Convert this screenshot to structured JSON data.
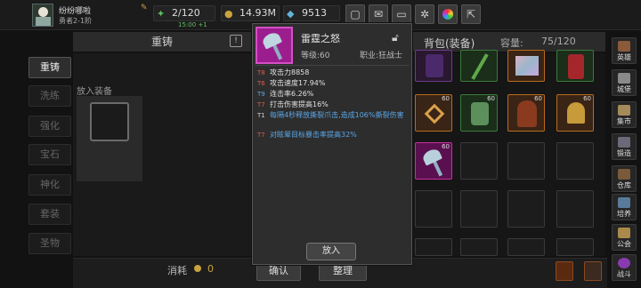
{
  "player": {
    "name": "纷纷哪啦",
    "rank": "勇者2-1阶"
  },
  "stats": {
    "stamina": "2/120",
    "stamina_timer": "15:00 +1",
    "gold": "14.93M",
    "gems": "9513"
  },
  "left_menu": [
    "重铸",
    "洗练",
    "强化",
    "宝石",
    "神化",
    "套装",
    "圣物"
  ],
  "forge": {
    "header": "重铸",
    "help": "!",
    "equip_label": "放入装备",
    "cost_label": "消耗",
    "cost_value": "0",
    "confirm_button": "确认"
  },
  "bag": {
    "title": "背包(装备)",
    "capacity_label": "容量:",
    "capacity_value": "75/120",
    "sort_button": "整理",
    "level_tags": [
      "60",
      "60",
      "60",
      "60",
      "60"
    ]
  },
  "right_rail": [
    "英雄",
    "城堡",
    "集市",
    "锻造",
    "仓库",
    "培养",
    "公会",
    "战斗"
  ],
  "tooltip": {
    "name": "雷霆之怒",
    "level": "等级:60",
    "class": "职业:狂战士",
    "lines": [
      {
        "tier": "T8",
        "text": "攻击力8858"
      },
      {
        "tier": "T6",
        "text": "攻击速度17.94%"
      },
      {
        "tier": "T9",
        "text": "连击率6.26%"
      },
      {
        "tier": "T7",
        "text": "打击伤害提高16%"
      },
      {
        "tier": "T1",
        "text": "每隔4秒释放撕裂爪击,造成106%撕裂伤害"
      },
      {
        "tier": "T7",
        "text": "对眩晕目标暴击率提高32%"
      }
    ],
    "place_button": "放入"
  },
  "colors": {
    "accent_gold": "#c9a33d",
    "rarity_epic": "#c82f9c",
    "skill_text": "#5ba6e6"
  }
}
